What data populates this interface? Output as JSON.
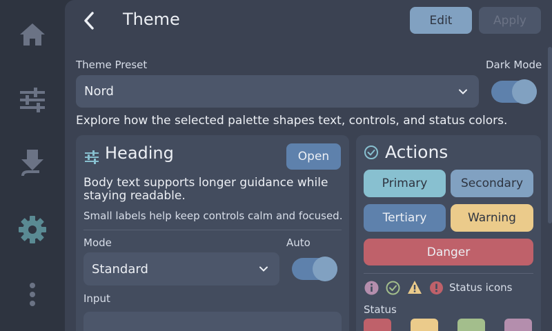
{
  "sidebar": {
    "items": [
      {
        "icon": "home-icon"
      },
      {
        "icon": "sliders-icon"
      },
      {
        "icon": "download-icon"
      },
      {
        "icon": "gear-icon"
      },
      {
        "icon": "more-vertical-icon"
      }
    ],
    "active_index": 3
  },
  "header": {
    "title": "Theme",
    "edit_label": "Edit",
    "apply_label": "Apply"
  },
  "preset": {
    "label": "Theme Preset",
    "value": "Nord",
    "dark_mode_label": "Dark Mode",
    "dark_mode_on": true
  },
  "description": "Explore how the selected palette shapes text, controls, and status colors.",
  "heading_card": {
    "title": "Heading",
    "open_label": "Open",
    "body": "Body text supports longer guidance while staying readable.",
    "small": "Small labels help keep controls calm and focused.",
    "mode_label": "Mode",
    "mode_value": "Standard",
    "auto_label": "Auto",
    "auto_on": true,
    "input_label": "Input"
  },
  "actions_card": {
    "title": "Actions",
    "buttons": {
      "primary": "Primary",
      "secondary": "Secondary",
      "tertiary": "Tertiary",
      "warning": "Warning",
      "danger": "Danger"
    },
    "status_icons_label": "Status icons",
    "status_label": "Status"
  },
  "colors": {
    "background": "#2e3440",
    "surface": "#3b4252",
    "card": "#434c5e",
    "primary": "#88c0d0",
    "secondary": "#81a1c1",
    "tertiary": "#5e81ac",
    "warning": "#ebcb8b",
    "danger": "#bf616a",
    "success": "#a3be8c",
    "info": "#b48ead"
  }
}
